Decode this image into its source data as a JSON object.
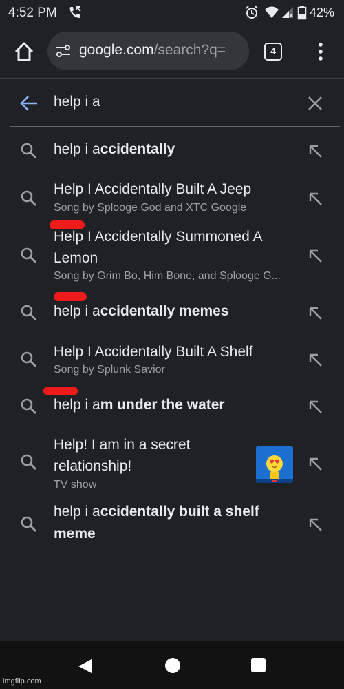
{
  "status_bar": {
    "time": "4:52 PM",
    "battery_percent": "42%",
    "icons": [
      "call-icon",
      "alarm-icon",
      "wifi-icon",
      "signal-icon",
      "battery-icon"
    ]
  },
  "toolbar": {
    "url_host": "google.com",
    "url_path": "/search?q=",
    "tab_count": "4",
    "icons": [
      "home-icon",
      "tune-icon",
      "tabs-icon",
      "menu-icon"
    ]
  },
  "search": {
    "query": "help i a",
    "icons": [
      "back-arrow-icon",
      "close-icon"
    ]
  },
  "suggestions": [
    {
      "prefix": "help i a",
      "bold": "ccidentally"
    },
    {
      "title": "Help I Accidentally Built A Jeep",
      "subtitle": "Song by Splooge God and XTC Google"
    },
    {
      "title_line1": "Help I Accidentally Summoned A",
      "title_line2": "Lemon",
      "subtitle": "Song by Grim Bo, Him Bone, and Splooge G..."
    },
    {
      "prefix": "help i a",
      "bold": "ccidentally memes"
    },
    {
      "title": "Help I Accidentally Built A Shelf",
      "subtitle": "Song by Splunk Savior"
    },
    {
      "prefix": "help i a",
      "bold": "m under the water"
    },
    {
      "title_line1": "Help! I am in a secret",
      "title_line2": "relationship!",
      "subtitle": "TV show",
      "thumbnail": "tv-show-thumbnail"
    },
    {
      "prefix": "help i a",
      "bold_line1": "ccidentally built a shelf",
      "bold_line2": "meme"
    }
  ],
  "colors": {
    "background": "#202124",
    "url_bar": "#35363a",
    "accent_blue": "#8ab4f8",
    "secondary_text": "#9aa0a6",
    "red_scribble": "#ee1b1b"
  },
  "watermark": "imgflip.com"
}
